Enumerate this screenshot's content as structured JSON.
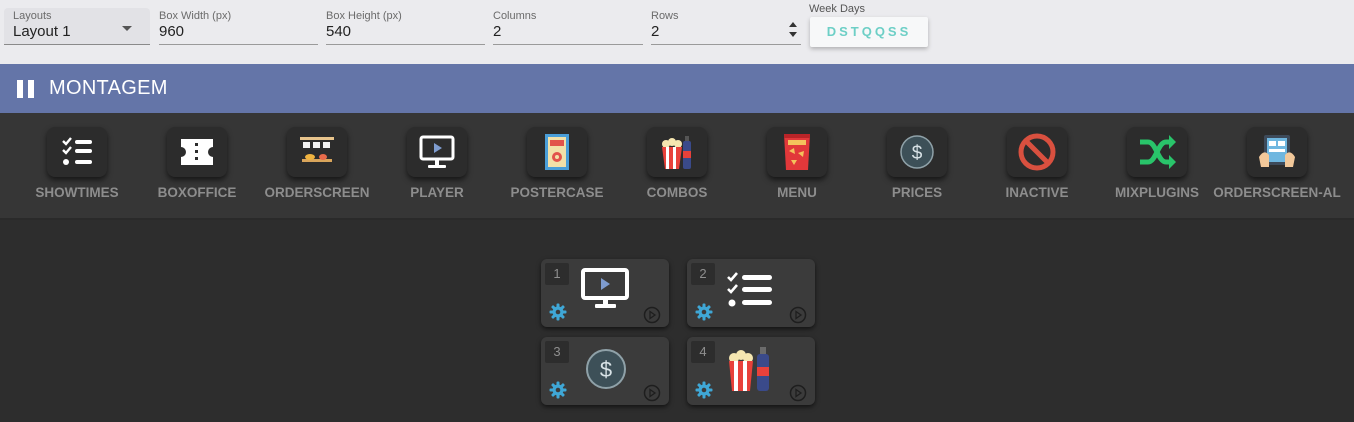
{
  "toolbar": {
    "layouts": {
      "label": "Layouts",
      "value": "Layout 1"
    },
    "box_width": {
      "label": "Box Width (px)",
      "value": "960"
    },
    "box_height": {
      "label": "Box Height (px)",
      "value": "540"
    },
    "columns": {
      "label": "Columns",
      "value": "2"
    },
    "rows": {
      "label": "Rows",
      "value": "2"
    },
    "week_days": {
      "label": "Week Days",
      "value": "DSTQQSS"
    }
  },
  "header": {
    "title": "MONTAGEM",
    "icon": "pause-icon",
    "color": "#6475a8"
  },
  "plugins": [
    {
      "label": "SHOWTIMES",
      "icon": "checklist-icon"
    },
    {
      "label": "BOXOFFICE",
      "icon": "ticket-icon"
    },
    {
      "label": "ORDERSCREEN",
      "icon": "orderscreen-icon"
    },
    {
      "label": "PLAYER",
      "icon": "monitor-play-icon"
    },
    {
      "label": "POSTERCASE",
      "icon": "poster-icon"
    },
    {
      "label": "COMBOS",
      "icon": "popcorn-soda-icon"
    },
    {
      "label": "MENU",
      "icon": "snack-bag-icon"
    },
    {
      "label": "PRICES",
      "icon": "dollar-icon"
    },
    {
      "label": "INACTIVE",
      "icon": "prohibited-icon"
    },
    {
      "label": "MIXPLUGINS",
      "icon": "shuffle-icon"
    },
    {
      "label": "ORDERSCREEN-AL",
      "icon": "tablet-hands-icon"
    }
  ],
  "grid": {
    "cells": [
      {
        "number": "1",
        "plugin": "PLAYER",
        "icon": "monitor-play-icon"
      },
      {
        "number": "2",
        "plugin": "SHOWTIMES",
        "icon": "checklist-icon"
      },
      {
        "number": "3",
        "plugin": "PRICES",
        "icon": "dollar-icon"
      },
      {
        "number": "4",
        "plugin": "COMBOS",
        "icon": "popcorn-soda-icon"
      }
    ]
  },
  "colors": {
    "accent": "#6dcfc6",
    "gear": "#3fa7d6",
    "panel": "#363636"
  }
}
